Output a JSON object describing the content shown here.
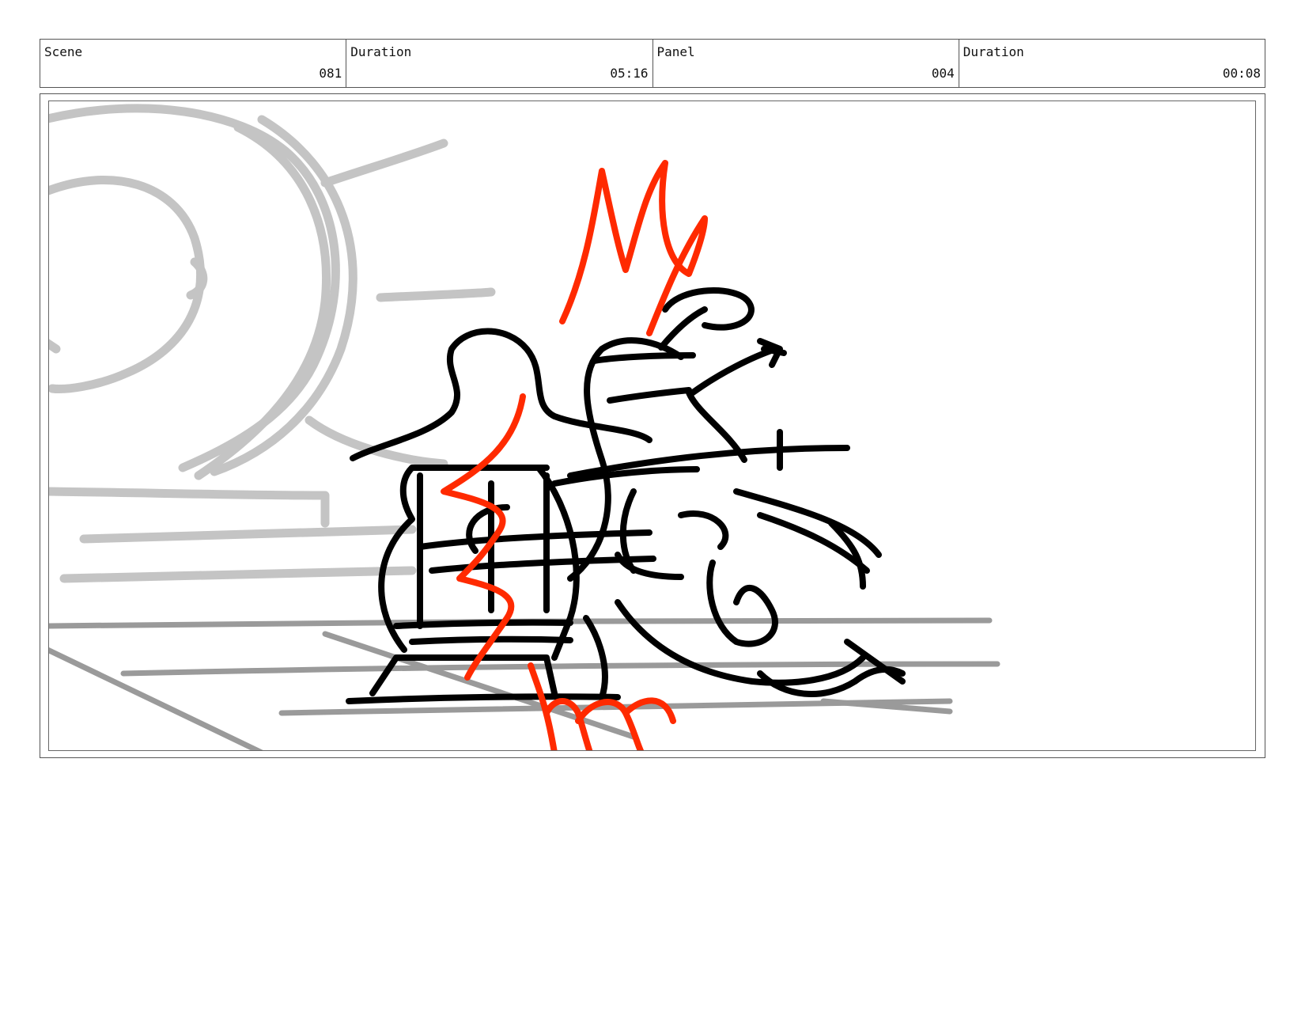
{
  "header": {
    "cells": [
      {
        "label": "Scene",
        "value": "081"
      },
      {
        "label": "Duration",
        "value": "05:16"
      },
      {
        "label": "Panel",
        "value": "004"
      },
      {
        "label": "Duration",
        "value": "00:08"
      }
    ]
  },
  "panel": {
    "colors": {
      "guide": "#c4c4c4",
      "floor": "#9a9a9a",
      "ink": "#000000",
      "effect": "#ff2a00"
    },
    "effect_text": "My shh"
  }
}
